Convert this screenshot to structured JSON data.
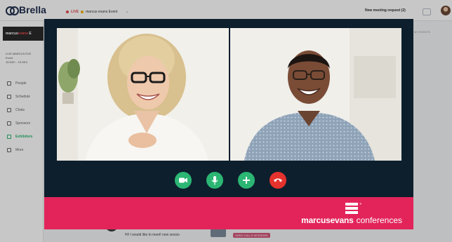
{
  "app": {
    "logo_text": "Brella",
    "live_label": "LIVE",
    "event_name": "marcus evans Event",
    "meeting_requests": "New meeting request (2)",
    "side_banner_main": "marcus",
    "side_banner_accent": "evans",
    "side_banner_tail": " E",
    "side_event_line1": "LIVE  MARCUS EVE",
    "side_event_line2": "Event",
    "side_event_line3": "15 DEC - 15 DEC",
    "nav": [
      {
        "label": "People",
        "icon": "people-icon"
      },
      {
        "label": "Schedule",
        "icon": "calendar-icon"
      },
      {
        "label": "Chats",
        "icon": "chat-icon"
      },
      {
        "label": "Sponsors",
        "icon": "sponsors-icon"
      },
      {
        "label": "Exhibitors",
        "icon": "exhibitors-icon"
      },
      {
        "label": "More",
        "icon": "more-icon"
      }
    ],
    "active_nav": "Exhibitors",
    "feed_text": "Hi! I would like to meet! new sessio",
    "feed_tag": "DRED CALLS SESSIONS",
    "right_col_text": "MY EVENTS"
  },
  "call": {
    "participants": [
      {
        "name": "participant-left"
      },
      {
        "name": "participant-right"
      }
    ],
    "controls": [
      {
        "name": "camera-button",
        "icon": "video-camera-icon"
      },
      {
        "name": "microphone-button",
        "icon": "microphone-icon"
      },
      {
        "name": "add-participant-button",
        "icon": "plus-icon"
      },
      {
        "name": "end-call-button",
        "icon": "hang-up-icon"
      }
    ]
  },
  "brand": {
    "bold": "marcusevans",
    "light": "conferences",
    "registered": "®"
  },
  "colors": {
    "call_bg": "#0d1f2d",
    "brand_bar": "#e2245a",
    "control_green": "#2bb673",
    "control_red": "#e5322d"
  }
}
